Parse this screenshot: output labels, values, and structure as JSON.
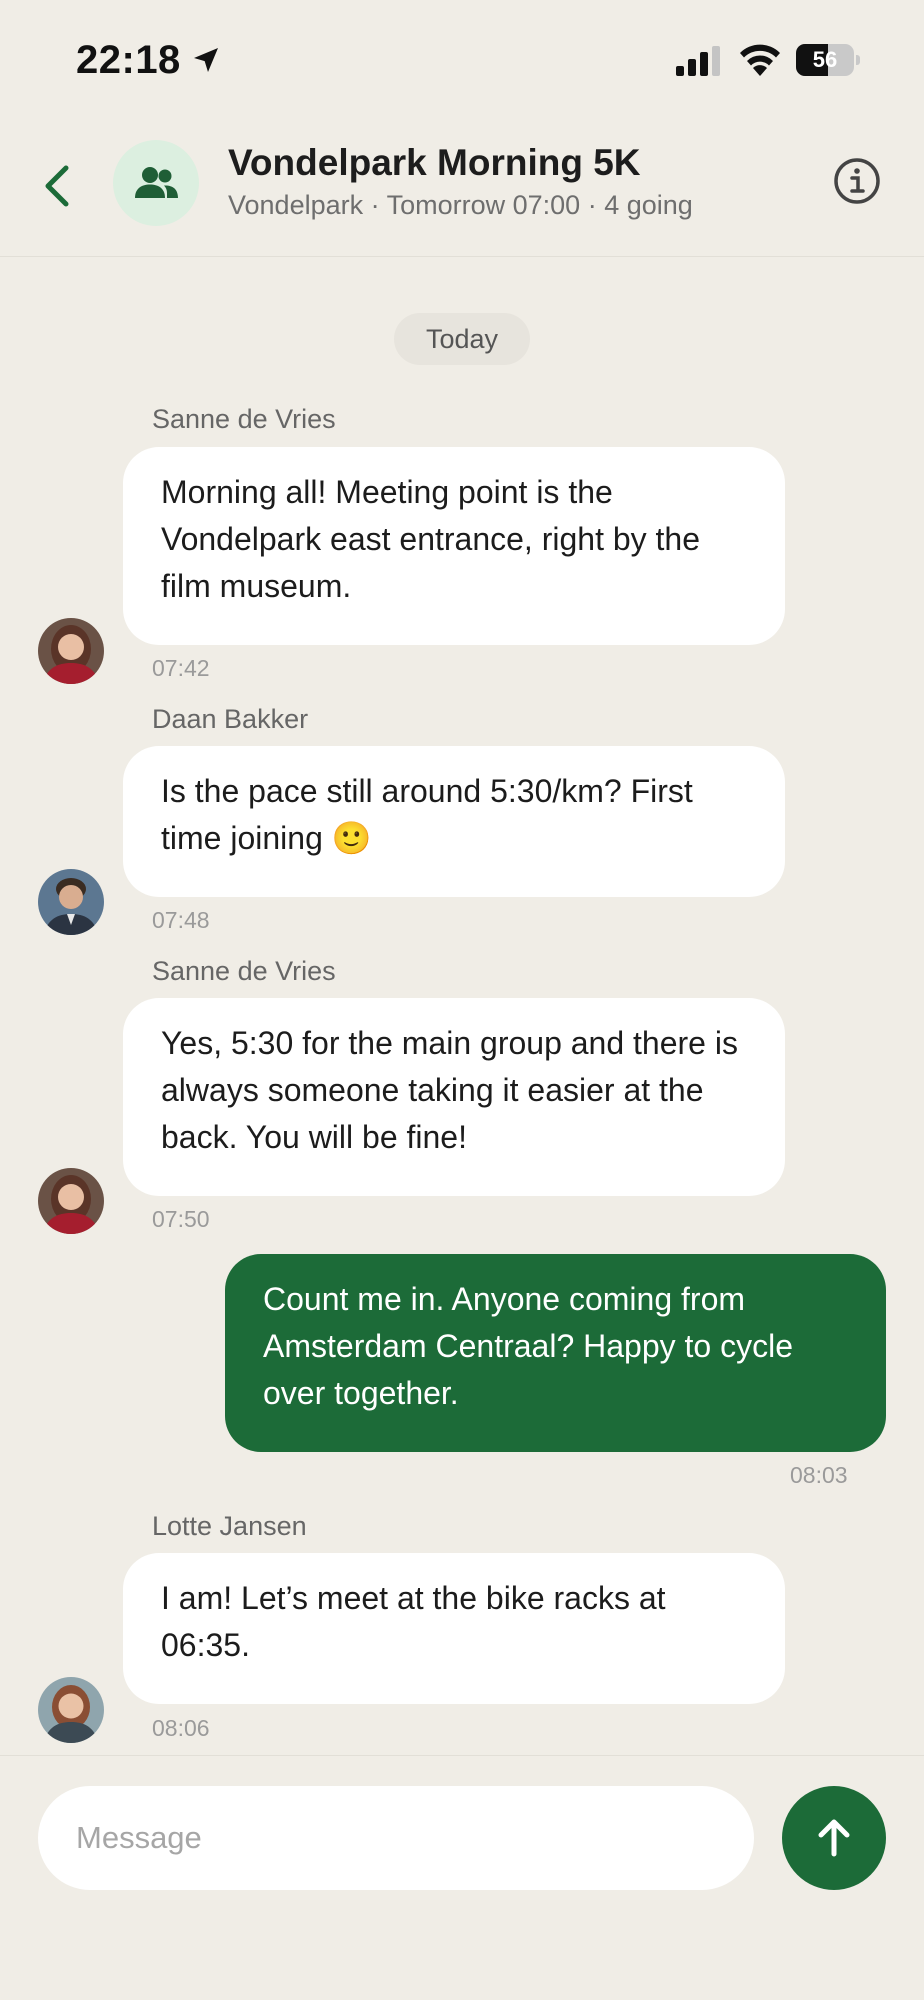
{
  "status_bar": {
    "time": "22:18",
    "battery_level": "56",
    "battery_fraction": 0.56
  },
  "header": {
    "title": "Vondelpark Morning 5K",
    "subtitle": "Vondelpark · Tomorrow 07:00 · 4 going",
    "icons": {
      "back": "chevron-left-icon",
      "group": "group-icon",
      "info": "info-icon"
    }
  },
  "date_separator": "Today",
  "messages": [
    {
      "sender": "Sanne de Vries",
      "text": "Morning all! Meeting point is the Vondelpark east entrance, right by the film museum.",
      "time": "07:42",
      "outgoing": false
    },
    {
      "sender": "Daan Bakker",
      "text": "Is the pace still around 5:30/km? First time joining 🙂",
      "time": "07:48",
      "outgoing": false
    },
    {
      "sender": "Sanne de Vries",
      "text": "Yes, 5:30 for the main group and there is always someone taking it easier at the back. You will be fine!",
      "time": "07:50",
      "outgoing": false
    },
    {
      "sender": "",
      "text": "Count me in. Anyone coming from Amsterdam Centraal? Happy to cycle over together.",
      "time": "08:03",
      "outgoing": true
    },
    {
      "sender": "Lotte Jansen",
      "text": "I am! Let’s meet at the bike racks at 06:35.",
      "time": "08:06",
      "outgoing": false
    }
  ],
  "composer": {
    "placeholder": "Message",
    "send_icon": "arrow-up-icon"
  },
  "colors": {
    "background": "#f0ede6",
    "accent": "#1c6b38",
    "incoming_bubble": "#ffffff",
    "group_avatar_bg": "#dcefe0"
  }
}
